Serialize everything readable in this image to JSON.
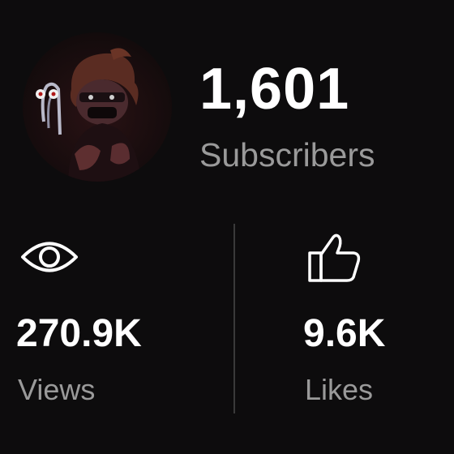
{
  "channel": {
    "avatar_icon": "channel-avatar"
  },
  "subscribers": {
    "count": "1,601",
    "label": "Subscribers"
  },
  "views": {
    "icon": "eye-icon",
    "value": "270.9K",
    "label": "Views"
  },
  "likes": {
    "icon": "thumbs-up-icon",
    "value": "9.6K",
    "label": "Likes"
  },
  "colors": {
    "background": "#0d0c0d",
    "primary_text": "#ffffff",
    "secondary_text": "#9a9a9a",
    "divider": "#3a3a3a"
  }
}
